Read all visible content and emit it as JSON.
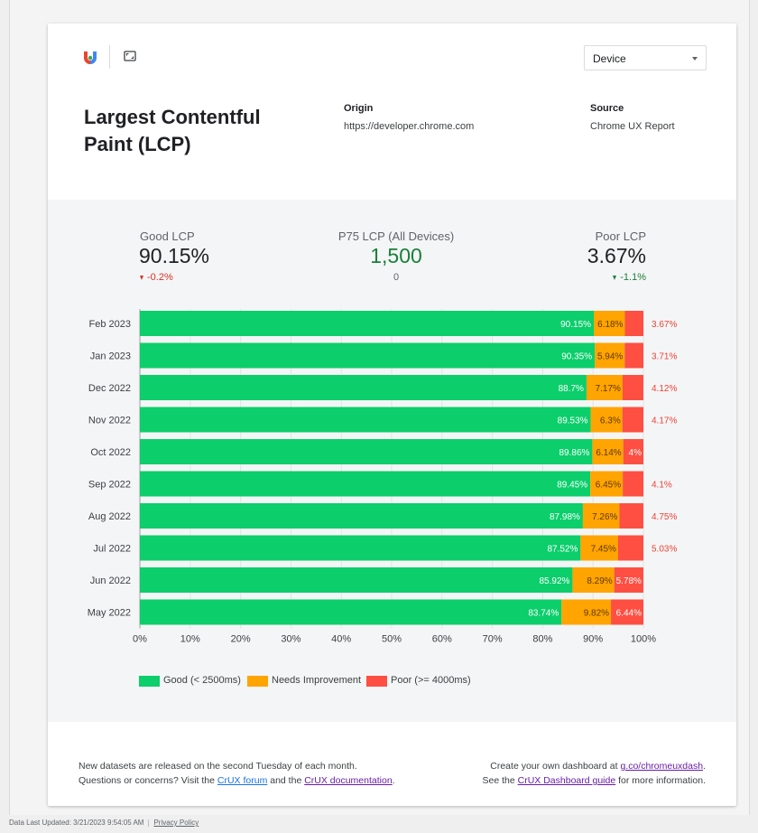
{
  "header": {
    "device_select": "Device",
    "title_line1": "Largest Contentful",
    "title_line2": "Paint (LCP)",
    "origin_label": "Origin",
    "origin_value": "https://developer.chrome.com",
    "source_label": "Source",
    "source_value": "Chrome UX Report"
  },
  "kpis": {
    "good": {
      "label": "Good LCP",
      "value": "90.15%",
      "delta": "-0.2%",
      "delta_color": "#d93025"
    },
    "p75": {
      "label": "P75 LCP (All Devices)",
      "value": "1,500",
      "sub": "0",
      "value_color": "#188038"
    },
    "poor": {
      "label": "Poor LCP",
      "value": "3.67%",
      "delta": "-1.1%",
      "delta_color": "#188038"
    }
  },
  "colors": {
    "good": "#0cce6b",
    "needs": "#ffa400",
    "poor": "#ff4e42",
    "poor_text": "#ea4335"
  },
  "chart_data": {
    "type": "bar",
    "orientation": "horizontal",
    "stacked": true,
    "categories": [
      "Feb 2023",
      "Jan 2023",
      "Dec 2022",
      "Nov 2022",
      "Oct 2022",
      "Sep 2022",
      "Aug 2022",
      "Jul 2022",
      "Jun 2022",
      "May 2022"
    ],
    "series": [
      {
        "name": "Good (< 2500ms)",
        "values": [
          90.15,
          90.35,
          88.7,
          89.53,
          89.86,
          89.45,
          87.98,
          87.52,
          85.92,
          83.74
        ],
        "labels": [
          "90.15%",
          "90.35%",
          "88.7%",
          "89.53%",
          "89.86%",
          "89.45%",
          "87.98%",
          "87.52%",
          "85.92%",
          "83.74%"
        ]
      },
      {
        "name": "Needs Improvement",
        "values": [
          6.18,
          5.94,
          7.17,
          6.3,
          6.14,
          6.45,
          7.26,
          7.45,
          8.29,
          9.82
        ],
        "labels": [
          "6.18%",
          "5.94%",
          "7.17%",
          "6.3%",
          "6.14%",
          "6.45%",
          "7.26%",
          "7.45%",
          "8.29%",
          "9.82%"
        ]
      },
      {
        "name": "Poor (>= 4000ms)",
        "values": [
          3.67,
          3.71,
          4.12,
          4.17,
          4.0,
          4.1,
          4.75,
          5.03,
          5.78,
          6.44
        ],
        "labels": [
          "3.67%",
          "3.71%",
          "4.12%",
          "4.17%",
          "4%",
          "4.1%",
          "4.75%",
          "5.03%",
          "5.78%",
          "6.44%"
        ]
      }
    ],
    "xlim": [
      0,
      100
    ],
    "x_ticks": [
      "0%",
      "10%",
      "20%",
      "30%",
      "40%",
      "50%",
      "60%",
      "70%",
      "80%",
      "90%",
      "100%"
    ],
    "legend_position": "bottom-left",
    "grid": true
  },
  "footer": {
    "l1": "New datasets are released on the second Tuesday of each month.",
    "l2_a": "Questions or concerns? Visit the ",
    "l2_link1": "CrUX forum",
    "l2_b": " and the ",
    "l2_link2": "CrUX documentation",
    "l2_c": ".",
    "r1_a": "Create your own dashboard at ",
    "r1_link": "g.co/chromeuxdash",
    "r1_b": ".",
    "r2_a": "See the ",
    "r2_link": "CrUX Dashboard guide",
    "r2_b": " for more information."
  },
  "bottom": {
    "updated": "Data Last Updated: 3/21/2023 9:54:05 AM",
    "privacy": "Privacy Policy"
  }
}
